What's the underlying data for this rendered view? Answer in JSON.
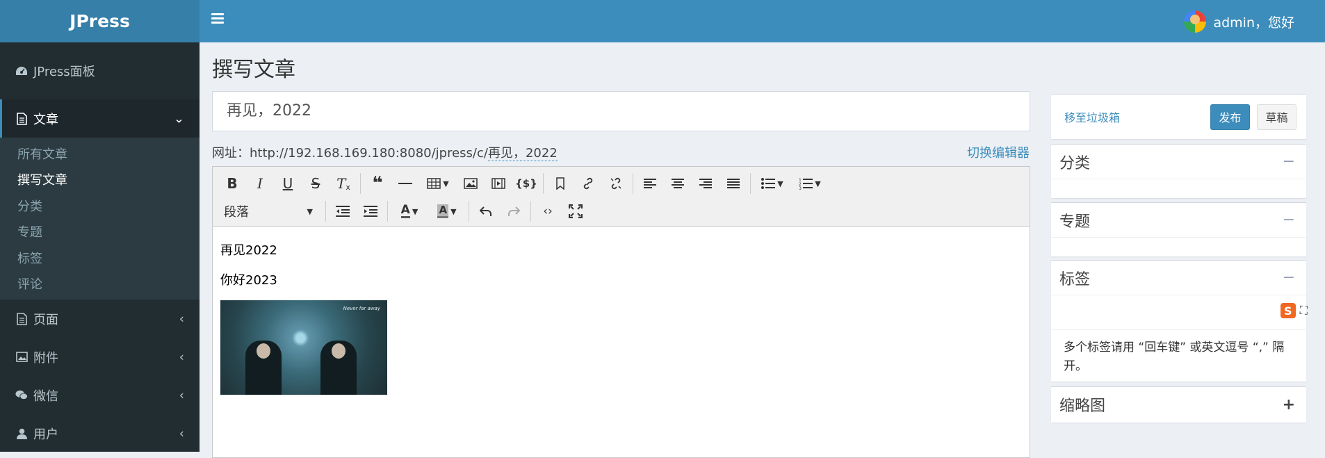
{
  "header": {
    "logo": "JPress",
    "user_greeting": "admin，您好"
  },
  "sidebar": {
    "dashboard": "JPress面板",
    "article": "文章",
    "sub_items": [
      "所有文章",
      "撰写文章",
      "分类",
      "专题",
      "标签",
      "评论"
    ],
    "page": "页面",
    "attachment": "附件",
    "wechat": "微信",
    "user": "用户"
  },
  "main": {
    "page_title": "撰写文章",
    "article_title": "再见，2022",
    "url_label": "网址：",
    "url_base": "http://192.168.169.180:8080/jpress/c/",
    "url_slug": "再见，2022",
    "switch_editor": "切换编辑器",
    "paragraph_select": "段落",
    "body_lines": [
      "再见2022",
      "你好2023"
    ],
    "image_caption": "Never far away"
  },
  "right_panel": {
    "trash": "移至垃圾箱",
    "publish": "发布",
    "draft": "草稿",
    "category": "分类",
    "topic": "专题",
    "tags": "标签",
    "tag_hint": "多个标签请用 “回车键” 或英文逗号 “,” 隔开。",
    "thumbnail": "缩略图",
    "collapse_symbol": "−",
    "expand_symbol": "+"
  }
}
